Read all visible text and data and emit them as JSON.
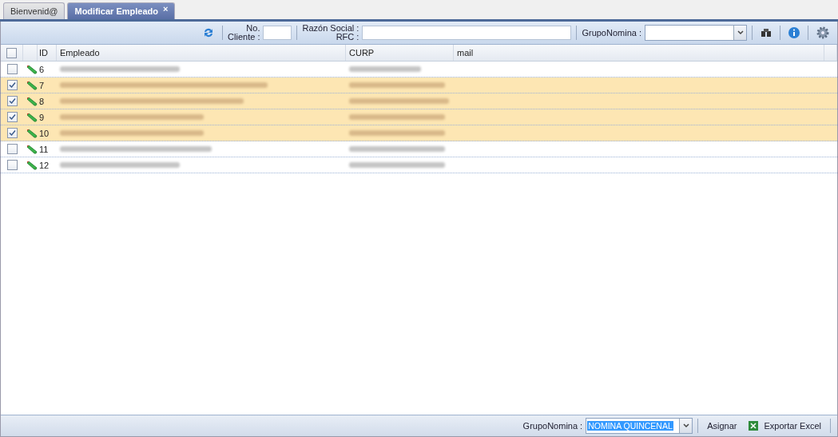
{
  "tabs": [
    {
      "label": "Bienvenid@",
      "selected": false
    },
    {
      "label": "Modificar Empleado",
      "selected": true,
      "close": "×"
    }
  ],
  "toolbar": {
    "no_cliente_label": [
      "No.",
      "Cliente :"
    ],
    "razon_label": [
      "Razón Social :",
      "RFC :"
    ],
    "grupo_label": "GrupoNomina :"
  },
  "table": {
    "all_checked": false,
    "columns": [
      "ID",
      "Empleado",
      "CURP",
      "mail"
    ],
    "rows": [
      {
        "id": "6",
        "selected": false
      },
      {
        "id": "7",
        "selected": true
      },
      {
        "id": "8",
        "selected": true
      },
      {
        "id": "9",
        "selected": true
      },
      {
        "id": "10",
        "selected": true
      },
      {
        "id": "11",
        "selected": false
      },
      {
        "id": "12",
        "selected": false
      }
    ]
  },
  "footer": {
    "grupo_label": "GrupoNomina :",
    "grupo_value": "NOMINA QUINCENAL",
    "assign": "Asignar",
    "export": "Exportar Excel"
  }
}
